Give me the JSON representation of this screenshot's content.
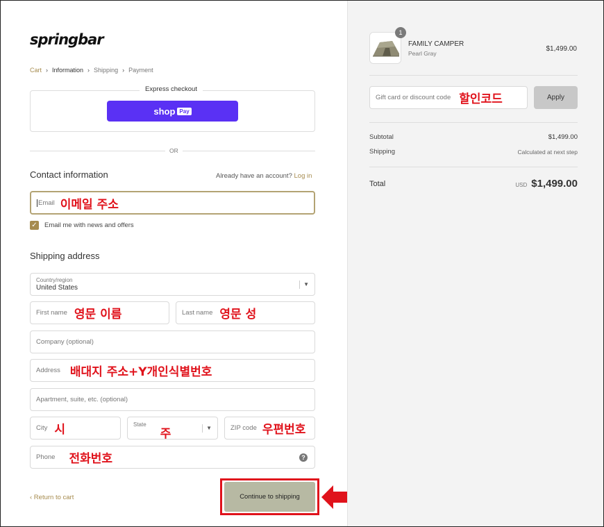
{
  "brand": {
    "logo": "springbar"
  },
  "breadcrumb": {
    "cart": "Cart",
    "information": "Information",
    "shipping": "Shipping",
    "payment": "Payment",
    "sep_icon": "chevron-right-icon",
    "sep": "›"
  },
  "express": {
    "title": "Express checkout",
    "shop_pay_label": "shop",
    "shop_pay_badge": "Pay"
  },
  "or_label": "OR",
  "contact": {
    "title": "Contact information",
    "account_prompt": "Already have an account?",
    "login_link": "Log in",
    "email_placeholder": "Email",
    "email_annotation": "이메일 주소",
    "newsletter_label": "Email me with news and offers",
    "newsletter_checked": true
  },
  "shipping": {
    "title": "Shipping address",
    "country_label": "Country/region",
    "country_value": "United States",
    "first_name_placeholder": "First name",
    "first_name_annotation": "영문 이름",
    "last_name_placeholder": "Last name",
    "last_name_annotation": "영문 성",
    "company_placeholder": "Company (optional)",
    "address_placeholder": "Address",
    "address_annotation": "배대지 주소+Y개인식별번호",
    "apartment_placeholder": "Apartment, suite, etc. (optional)",
    "city_placeholder": "City",
    "city_annotation": "시",
    "state_placeholder": "State",
    "state_annotation": "주",
    "zip_placeholder": "ZIP code",
    "zip_annotation": "우편번호",
    "phone_placeholder": "Phone",
    "phone_annotation": "전화번호"
  },
  "footer": {
    "return_label": "‹ Return to cart",
    "continue_label": "Continue to shipping"
  },
  "order": {
    "quantity": "1",
    "product_name": "FAMILY CAMPER",
    "product_variant": "Pearl Gray",
    "product_price": "$1,499.00",
    "discount_placeholder": "Gift card or discount code",
    "discount_annotation": "할인코드",
    "apply_label": "Apply",
    "subtotal_label": "Subtotal",
    "subtotal_value": "$1,499.00",
    "shipping_label": "Shipping",
    "shipping_value": "Calculated at next step",
    "total_label": "Total",
    "total_currency": "USD",
    "total_value": "$1,499.00"
  },
  "colors": {
    "accent": "#a68b4e",
    "shop_pay": "#5a31f4",
    "annotation": "#e0121b",
    "continue_bg": "#b7b9a3"
  }
}
